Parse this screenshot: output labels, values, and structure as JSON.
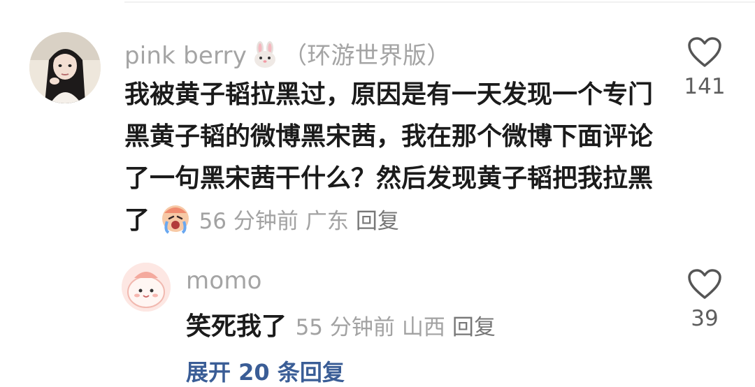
{
  "comments": [
    {
      "username": "pink berry",
      "username_suffix": "（环游世界版）",
      "text": "我被黄子韬拉黑过，原因是有一天发现一个专门黑黄子韬的微博黑宋茜，我在那个微博下面评论了一句黑宋茜干什么？然后发现黄子韬把我拉黑了",
      "time": "56 分钟前",
      "location": "广东",
      "reply_label": "回复",
      "likes": "141",
      "icons": {
        "avatar": "avatar-photo",
        "emoji": "crying-face-emoji",
        "like": "heart-outline-icon"
      }
    }
  ],
  "reply": {
    "username": "momo",
    "text": "笑死我了",
    "time": "55 分钟前",
    "location": "山西",
    "reply_label": "回复",
    "likes": "39",
    "icons": {
      "avatar": "avatar-illustration",
      "like": "heart-outline-icon"
    }
  },
  "expand_label": "展开 20 条回复",
  "colors": {
    "muted": "#a4a4a4",
    "text": "#1b1b1b",
    "link": "#3a5d96"
  }
}
